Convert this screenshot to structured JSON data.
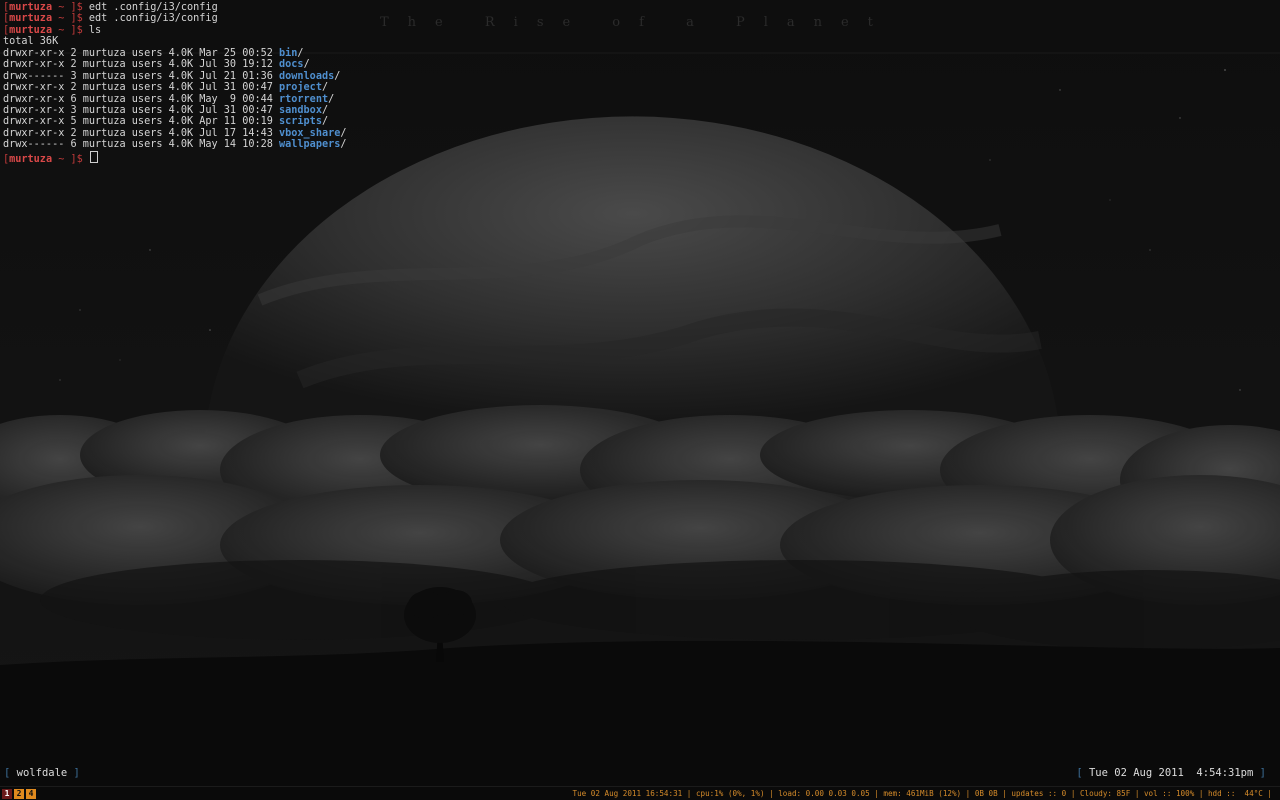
{
  "wallpaper": {
    "title": "The Rise of a Planet"
  },
  "terminal": {
    "prompt": {
      "open_bracket": "[",
      "user": "murtuza",
      "path": " ~ ",
      "close": "]$"
    },
    "commands": [
      " edt .config/i3/config",
      " edt .config/i3/config",
      " ls"
    ],
    "total": "total 36K",
    "listing": [
      {
        "meta": "drwxr-xr-x 2 murtuza users 4.0K Mar 25 00:52 ",
        "name": "bin",
        "slash": "/"
      },
      {
        "meta": "drwxr-xr-x 2 murtuza users 4.0K Jul 30 19:12 ",
        "name": "docs",
        "slash": "/"
      },
      {
        "meta": "drwx------ 3 murtuza users 4.0K Jul 21 01:36 ",
        "name": "downloads",
        "slash": "/"
      },
      {
        "meta": "drwxr-xr-x 2 murtuza users 4.0K Jul 31 00:47 ",
        "name": "project",
        "slash": "/"
      },
      {
        "meta": "drwxr-xr-x 6 murtuza users 4.0K May  9 00:44 ",
        "name": "rtorrent",
        "slash": "/"
      },
      {
        "meta": "drwxr-xr-x 3 murtuza users 4.0K Jul 31 00:47 ",
        "name": "sandbox",
        "slash": "/"
      },
      {
        "meta": "drwxr-xr-x 5 murtuza users 4.0K Apr 11 00:19 ",
        "name": "scripts",
        "slash": "/"
      },
      {
        "meta": "drwxr-xr-x 2 murtuza users 4.0K Jul 17 14:43 ",
        "name": "vbox_share",
        "slash": "/"
      },
      {
        "meta": "drwx------ 6 murtuza users 4.0K May 14 10:28 ",
        "name": "wallpapers",
        "slash": "/"
      }
    ]
  },
  "conky": {
    "host_open": "[ ",
    "host": "wolfdale",
    "host_close": " ]",
    "datetime_open": "[ ",
    "datetime": "Tue 02 Aug 2011  4:54:31pm",
    "datetime_close": " ]"
  },
  "bar": {
    "workspaces": [
      "1",
      "2",
      "4"
    ],
    "status": "Tue 02 Aug 2011 16:54:31 | cpu:1% (0%, 1%) | load: 0.00 0.03 0.05 | mem: 461MiB (12%) | 0B 0B | updates :: 0 | Cloudy: 85F | vol :: 100% | hdd ::  44°C |"
  },
  "colors": {
    "background": "#0b0b0b",
    "prompt_user": "#d94848",
    "directory": "#4f8fcf",
    "workspace_focused": "#6b1a1a",
    "workspace_other": "#e08a1e",
    "status_text": "#d58b2a"
  }
}
